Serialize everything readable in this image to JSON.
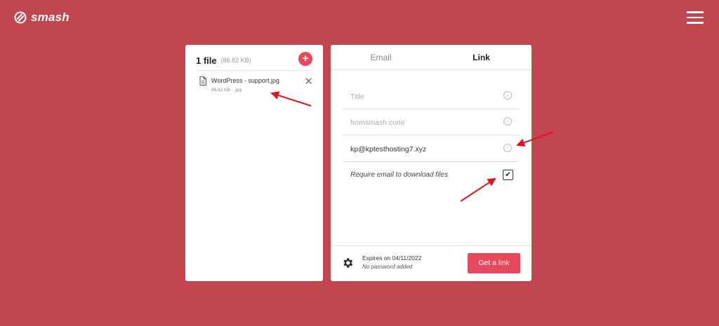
{
  "header": {
    "brand": "smash"
  },
  "files": {
    "count_label": "1 file",
    "total_size": "(86.82 KB)",
    "add_icon": "plus-icon",
    "items": [
      {
        "name": "WordPress - support.jpg",
        "meta": "86.82 KB  -  .jpg",
        "icon": "file-icon",
        "remove_icon": "close-icon"
      }
    ]
  },
  "transfer": {
    "tabs": [
      {
        "label": "Email",
        "active": false
      },
      {
        "label": "Link",
        "active": true
      }
    ],
    "fields": {
      "title_placeholder": "Title",
      "url_placeholder": "fromsmash.com/",
      "email_value": "kp@kptesthosting7.xyz"
    },
    "require_email_label": "Require email to download files",
    "require_email_checked": true,
    "expires": "Expires on 04/11/2022",
    "password": "No password added",
    "get_link_label": "Get a link"
  },
  "colors": {
    "background": "#c1464f",
    "accent": "#e5495b",
    "annotation_arrow": "#e0141f"
  }
}
